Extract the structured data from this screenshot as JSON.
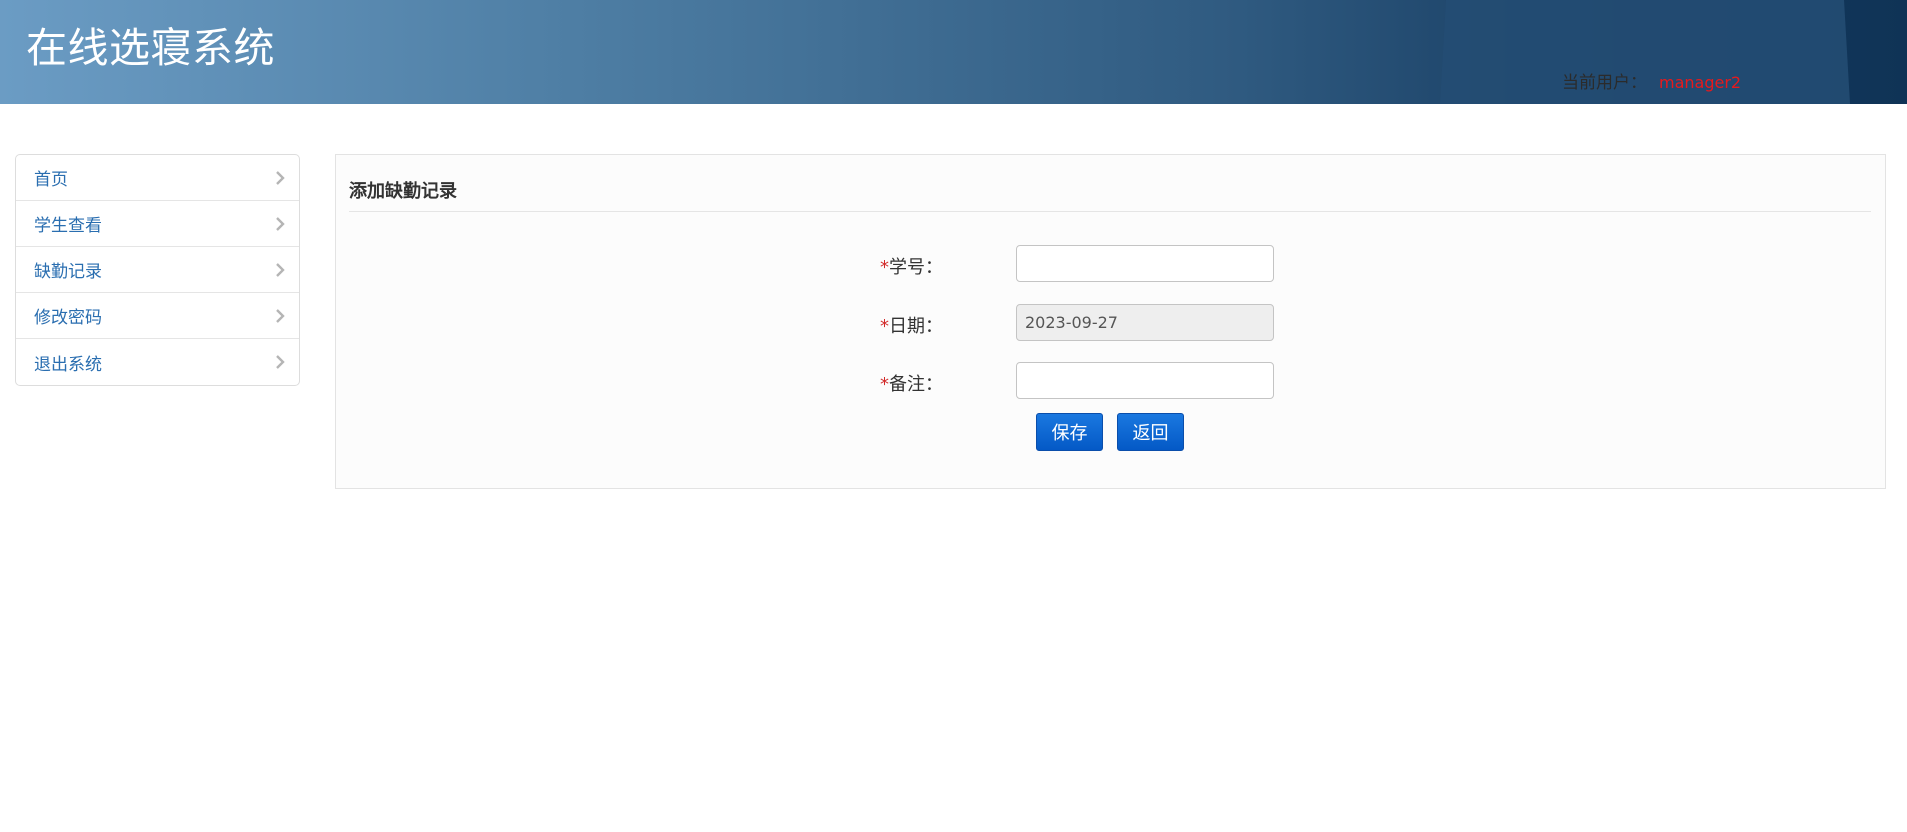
{
  "header": {
    "title": "在线选寝系统",
    "user_label": "当前用户：",
    "user_name": "manager2"
  },
  "sidebar": {
    "items": [
      {
        "label": "首页"
      },
      {
        "label": "学生查看"
      },
      {
        "label": "缺勤记录"
      },
      {
        "label": "修改密码"
      },
      {
        "label": "退出系统"
      }
    ]
  },
  "main": {
    "title": "添加缺勤记录",
    "form": {
      "student_id": {
        "label": "学号：",
        "value": ""
      },
      "date": {
        "label": "日期：",
        "value": "2023-09-27"
      },
      "remark": {
        "label": "备注：",
        "value": ""
      }
    },
    "buttons": {
      "save": "保存",
      "back": "返回"
    }
  },
  "colors": {
    "header_gradient_start": "#6b9cc4",
    "header_gradient_end": "#0f3356",
    "user_name": "#e8191c",
    "link": "#2a6eb0",
    "button": "#0459c6",
    "required": "#d22a2a"
  },
  "icons": {
    "chevron": "chevron-right-icon"
  }
}
